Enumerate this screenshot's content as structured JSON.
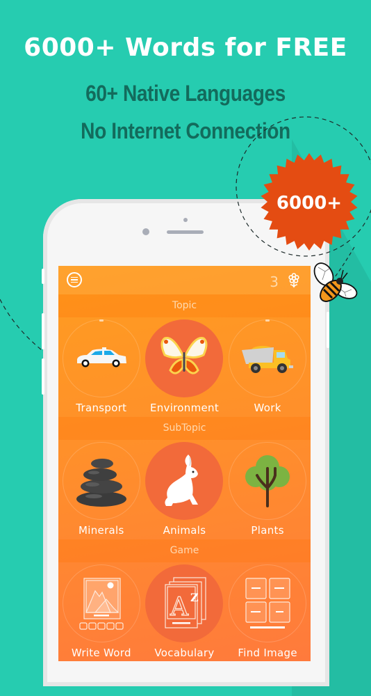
{
  "promo": {
    "headline": "6000+ Words for FREE",
    "subline_1": "60+ Native Languages",
    "subline_2": "No Internet Connection",
    "badge": "6000+"
  },
  "colors": {
    "background": "#26ccb0",
    "subtext": "#136b5c",
    "badge": "#e44c12",
    "screen_top": "#ff9d20",
    "screen_bottom": "#ff7a3c",
    "active_circle": "#f26a3a"
  },
  "app": {
    "topbar": {
      "menu_icon": "hamburger-menu-icon",
      "counter": "3",
      "settings_icon": "flower-settings-icon"
    },
    "sections": [
      {
        "title": "Topic",
        "items": [
          {
            "label": "Transport",
            "icon": "car-icon",
            "active": false
          },
          {
            "label": "Environment",
            "icon": "butterfly-icon",
            "active": true
          },
          {
            "label": "Work",
            "icon": "dump-truck-icon",
            "active": false
          }
        ]
      },
      {
        "title": "SubTopic",
        "items": [
          {
            "label": "Minerals",
            "icon": "stones-icon",
            "active": false
          },
          {
            "label": "Animals",
            "icon": "rabbit-icon",
            "active": true
          },
          {
            "label": "Plants",
            "icon": "tree-icon",
            "active": false
          }
        ]
      },
      {
        "title": "Game",
        "items": [
          {
            "label": "Write Word",
            "icon": "picture-letters-icon",
            "active": false
          },
          {
            "label": "Vocabulary",
            "icon": "az-cards-icon",
            "active": true
          },
          {
            "label": "Find Image",
            "icon": "grid-cards-icon",
            "active": false
          }
        ]
      }
    ]
  }
}
